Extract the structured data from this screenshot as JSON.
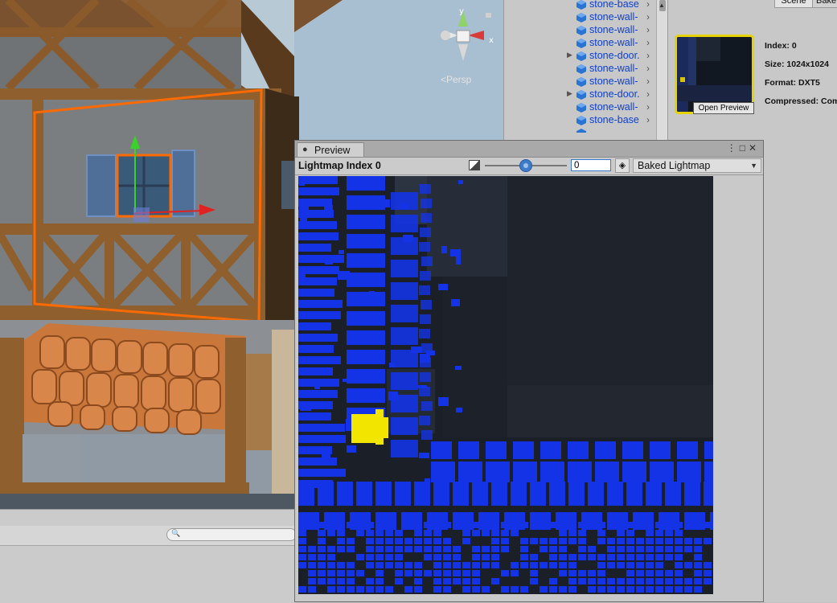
{
  "scene": {
    "persp_label": "<Persp",
    "gizmo_y": "y",
    "gizmo_x": "x"
  },
  "hierarchy": {
    "items": [
      {
        "label": "stone-base",
        "expandable": false
      },
      {
        "label": "stone-wall-",
        "expandable": false
      },
      {
        "label": "stone-wall-",
        "expandable": false
      },
      {
        "label": "stone-wall-",
        "expandable": false
      },
      {
        "label": "stone-door.",
        "expandable": true
      },
      {
        "label": "stone-wall-",
        "expandable": false
      },
      {
        "label": "stone-wall-",
        "expandable": false
      },
      {
        "label": "stone-door.",
        "expandable": true
      },
      {
        "label": "stone-wall-",
        "expandable": false
      },
      {
        "label": "stone-base",
        "expandable": false
      }
    ]
  },
  "inspector": {
    "tab_scene": "Scene",
    "tab_bake": "Bake",
    "open_preview": "Open Preview",
    "index": "Index: 0",
    "size": "Size: 1024x1024",
    "format": "Format: DXT5",
    "compressed": "Compressed: Comp"
  },
  "preview": {
    "tab_label": "Preview",
    "title": "Lightmap Index 0",
    "exposure_value": "0",
    "exposure_fraction": 0.5,
    "mode": "Baked Lightmap"
  },
  "colors": {
    "uv_blue": "#1433e6",
    "uv_selected": "#f2e600",
    "selection_orange": "#ff6a00",
    "hierarchy_text": "#0b3fd6",
    "thumb_border": "#e7d300"
  }
}
